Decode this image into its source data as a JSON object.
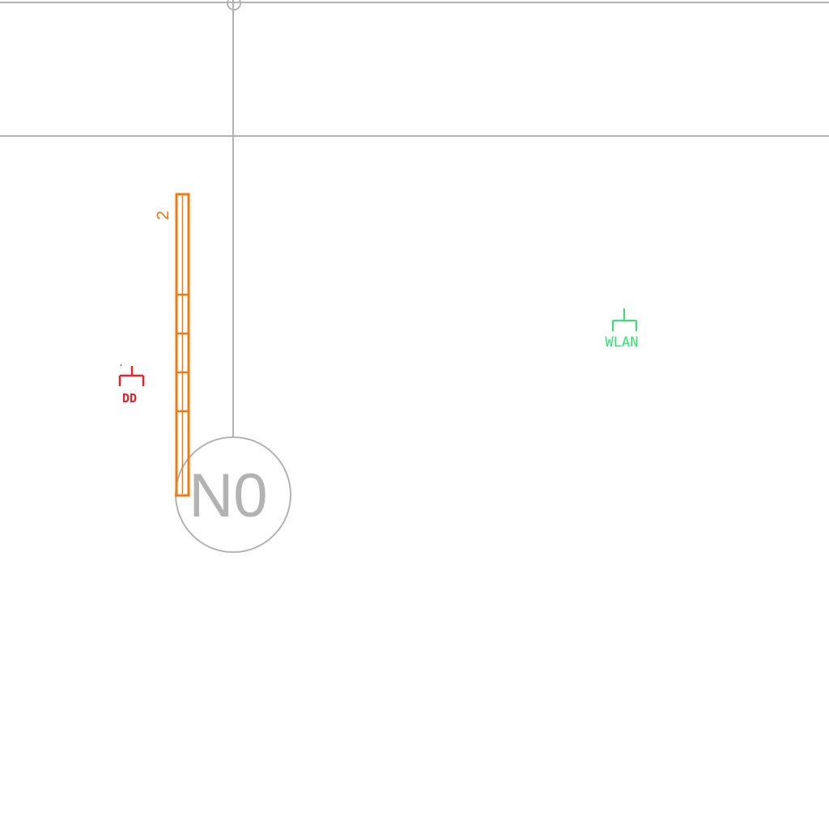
{
  "colors": {
    "background": "#ffffff",
    "grid_line": "#b3b3b3",
    "axis_bubble": "#b3b3b3",
    "cable_tray": "#f07a10",
    "data_outlet": "#e8242a",
    "wlan_outlet": "#2ee86a"
  },
  "grid_axis": {
    "label": "N0"
  },
  "cable_tray": {
    "label": "2",
    "segments": 5
  },
  "data_outlet": {
    "symbol": "data-outlet-icon",
    "label": "DD"
  },
  "wlan_outlet": {
    "symbol": "wlan-outlet-icon",
    "label": "WLAN"
  }
}
